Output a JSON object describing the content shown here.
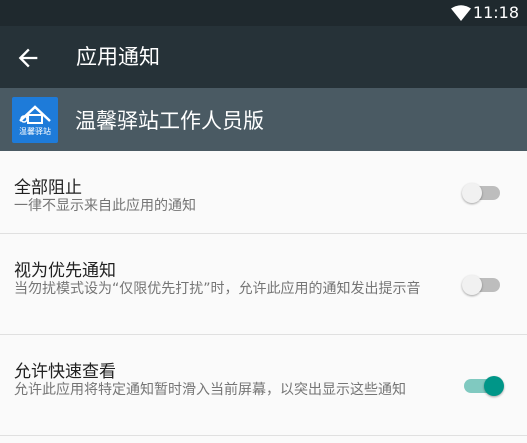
{
  "status_bar": {
    "time": "11:18",
    "wifi_icon": "wifi-icon"
  },
  "toolbar": {
    "back_icon": "arrow-back-icon",
    "title": "应用通知"
  },
  "app_header": {
    "icon_label": "温馨驿站",
    "name": "温馨驿站工作人员版"
  },
  "settings": [
    {
      "title": "全部阻止",
      "description": "一律不显示来自此应用的通知",
      "enabled": false
    },
    {
      "title": "视为优先通知",
      "description": "当勿扰模式设为“仅限优先打扰”时，允许此应用的通知发出提示音",
      "enabled": false
    },
    {
      "title": "允许快速查看",
      "description": "允许此应用将特定通知暂时滑入当前屏幕，以突出显示这些通知",
      "enabled": true
    }
  ],
  "colors": {
    "status_bar": "#1f292e",
    "toolbar": "#263238",
    "app_header": "#4a5a63",
    "accent": "#009688"
  }
}
